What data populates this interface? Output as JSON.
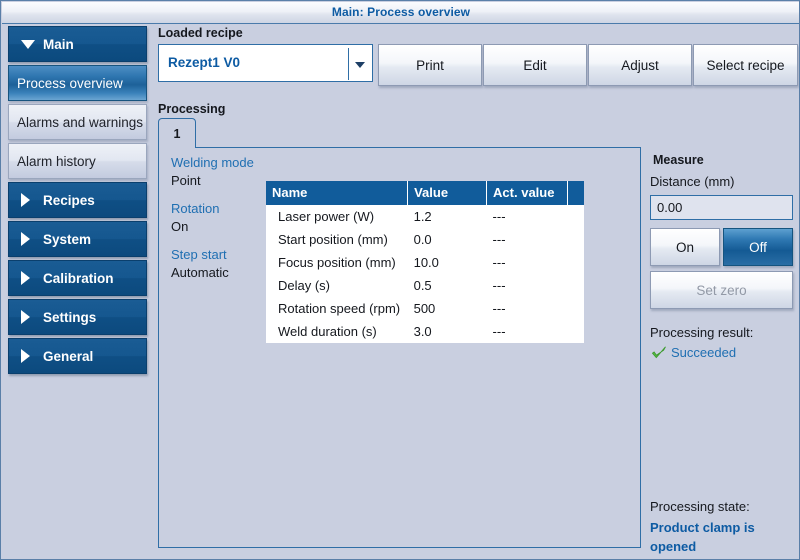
{
  "window": {
    "title": "Main: Process overview"
  },
  "sidebar": {
    "items": [
      {
        "label": "Main",
        "type": "group",
        "icon": "caret-down-icon",
        "expanded": true,
        "selected": false
      },
      {
        "label": "Process overview",
        "type": "child",
        "icon": "",
        "expanded": false,
        "selected": true
      },
      {
        "label": "Alarms and warnings",
        "type": "child",
        "icon": "",
        "expanded": false,
        "selected": false
      },
      {
        "label": "Alarm history",
        "type": "child",
        "icon": "",
        "expanded": false,
        "selected": false
      },
      {
        "label": "Recipes",
        "type": "group",
        "icon": "caret-right-icon",
        "expanded": false,
        "selected": false
      },
      {
        "label": "System",
        "type": "group",
        "icon": "caret-right-icon",
        "expanded": false,
        "selected": false
      },
      {
        "label": "Calibration",
        "type": "group",
        "icon": "caret-right-icon",
        "expanded": false,
        "selected": false
      },
      {
        "label": "Settings",
        "type": "group",
        "icon": "caret-right-icon",
        "expanded": false,
        "selected": false
      },
      {
        "label": "General",
        "type": "group",
        "icon": "caret-right-icon",
        "expanded": false,
        "selected": false
      }
    ]
  },
  "recipe": {
    "section_label": "Loaded recipe",
    "selected": "Rezept1 V0",
    "buttons": [
      {
        "label": "Print"
      },
      {
        "label": "Edit"
      },
      {
        "label": "Adjust"
      },
      {
        "label": "Select recipe"
      }
    ]
  },
  "processing": {
    "section_label": "Processing",
    "tabs": [
      {
        "label": "1",
        "active": true
      }
    ],
    "modes": [
      {
        "name": "Welding mode",
        "value": "Point"
      },
      {
        "name": "Rotation",
        "value": "On"
      },
      {
        "name": "Step start",
        "value": "Automatic"
      }
    ],
    "table": {
      "columns": [
        "Name",
        "Value",
        "Act. value",
        ""
      ],
      "rows": [
        {
          "name": "Laser power (W)",
          "value": "1.2",
          "act_value": "---"
        },
        {
          "name": "Start position (mm)",
          "value": "0.0",
          "act_value": "---"
        },
        {
          "name": "Focus position (mm)",
          "value": "10.0",
          "act_value": "---"
        },
        {
          "name": "Delay (s)",
          "value": "0.5",
          "act_value": "---"
        },
        {
          "name": "Rotation speed (rpm)",
          "value": "500",
          "act_value": "---"
        },
        {
          "name": "Weld duration (s)",
          "value": "3.0",
          "act_value": "---"
        }
      ]
    }
  },
  "measure": {
    "title": "Measure",
    "distance_label": "Distance (mm)",
    "distance_value": "0.00",
    "on_label": "On",
    "off_label": "Off",
    "set_zero_label": "Set zero",
    "result_label": "Processing result:",
    "result_value": "Succeeded",
    "state_label": "Processing state:",
    "state_value": "Product clamp is opened"
  },
  "colors": {
    "accent_blue": "#0d5ba3",
    "header_blue": "#115c9b",
    "background": "#c9cfe0",
    "success_green": "#4caf3f",
    "label_blue": "#1f6fb2"
  }
}
